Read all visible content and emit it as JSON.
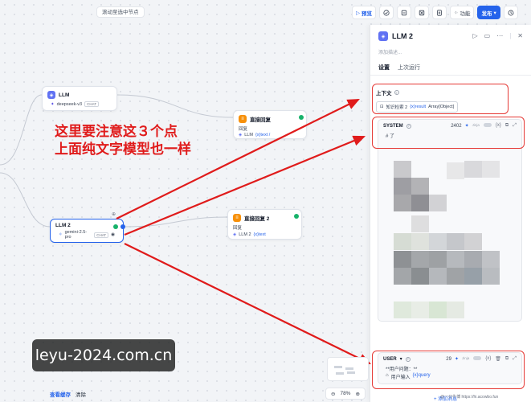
{
  "canvas": {
    "scroll_hint": "滚动至选中节点"
  },
  "toolbar": {
    "preview": "预览",
    "features": "功能",
    "publish": "发布"
  },
  "nodes": {
    "llm1": {
      "title": "LLM",
      "model": "deepseek-v3",
      "tag": "CHAT"
    },
    "llm2": {
      "title": "LLM 2",
      "model": "gemini-2.5-pro",
      "tag": "CHAT"
    },
    "answer1": {
      "title": "直接回复",
      "label": "回复",
      "var_node": "LLM",
      "var_name": "{x}text /"
    },
    "answer2": {
      "title": "直接回复 2",
      "label": "回复",
      "var_node": "LLM 2",
      "var_name": "{x}text"
    }
  },
  "annotation": {
    "line1": "这里要注意这３个点",
    "line2": "上面纯文字模型也一样"
  },
  "panel": {
    "title": "LLM 2",
    "description_placeholder": "添加描述...",
    "tabs": [
      "设置",
      "上次运行"
    ],
    "context": {
      "label": "上下文",
      "source": "知识检索 2",
      "var": "{x}result",
      "type": "Array[Object]"
    },
    "system": {
      "role": "SYSTEM",
      "count": "2402",
      "jinja": "Jinja",
      "preview": "# 了"
    },
    "user": {
      "role": "USER",
      "count": "29",
      "jinja": "Jinja",
      "text": "**用户问题：**",
      "var_node": "用户输入",
      "var_name": "{x}query"
    },
    "add_message": "+ 添加消息"
  },
  "bottom": {
    "view_cache": "查看缓存",
    "clear": "清除",
    "zoom": "78%"
  },
  "watermark": "leyu-2024.com.cn",
  "site_credit": "@一只牛博 https://hi.acowbo.fun",
  "colors": {
    "accent": "#2563eb",
    "annotation_red": "#e01b1b",
    "llm_icon": "#6172f3",
    "answer_icon": "#f79009",
    "success": "#17b26a"
  }
}
